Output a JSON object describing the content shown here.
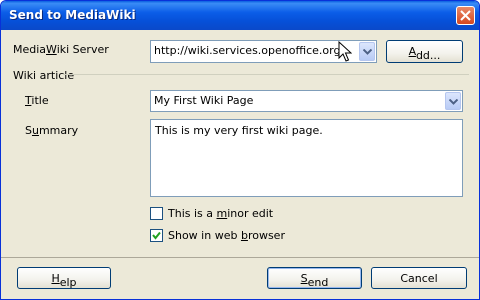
{
  "window": {
    "title": "Send to MediaWiki"
  },
  "server": {
    "label_pre": "Media",
    "label_accel": "W",
    "label_post": "iki Server",
    "value": "http://wiki.services.openoffice.org/w/",
    "add_pre": "",
    "add_accel": "A",
    "add_post": "dd..."
  },
  "article": {
    "group_label": "Wiki article",
    "title_label_accel": "T",
    "title_label_post": "itle",
    "title_value": "My First Wiki Page",
    "summary_label_pre": "S",
    "summary_label_accel": "u",
    "summary_label_post": "mmary",
    "summary_value": "This is my very first wiki page."
  },
  "options": {
    "minor_pre": "This is a ",
    "minor_accel": "m",
    "minor_post": "inor edit",
    "minor_checked": false,
    "browser_pre": "Show in web ",
    "browser_accel": "b",
    "browser_post": "rowser",
    "browser_checked": true
  },
  "buttons": {
    "help_accel": "H",
    "help_post": "elp",
    "send_accel": "S",
    "send_post": "end",
    "cancel": "Cancel"
  }
}
